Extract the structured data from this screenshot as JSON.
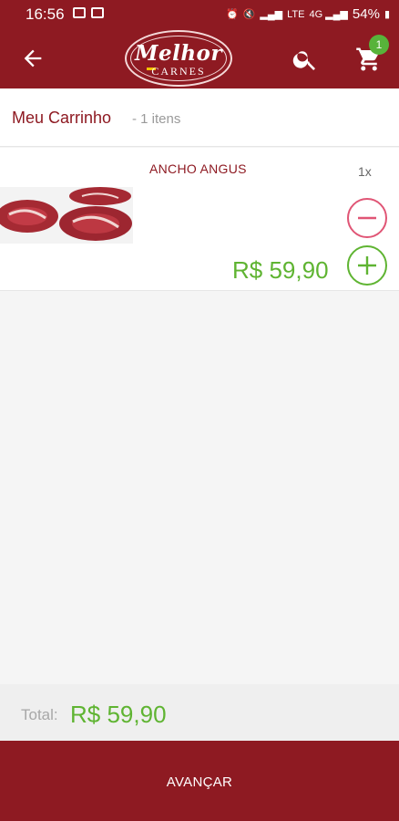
{
  "status_bar": {
    "time": "16:56",
    "battery": "54%"
  },
  "header": {
    "logo_top": "Melhor",
    "logo_bottom": "CARNES",
    "cart_badge": "1",
    "brand_color": "#8e1a22"
  },
  "cart": {
    "title": "Meu Carrinho",
    "count": "- 1 itens"
  },
  "items": [
    {
      "name": "ANCHO ANGUS",
      "quantity": "1x",
      "price": "R$ 59,90",
      "image": "meat-steak-image"
    }
  ],
  "totals": {
    "label": "Total:",
    "value": "R$ 59,90",
    "price_color": "#5fb432"
  },
  "footer": {
    "advance_label": "AVANÇAR"
  }
}
